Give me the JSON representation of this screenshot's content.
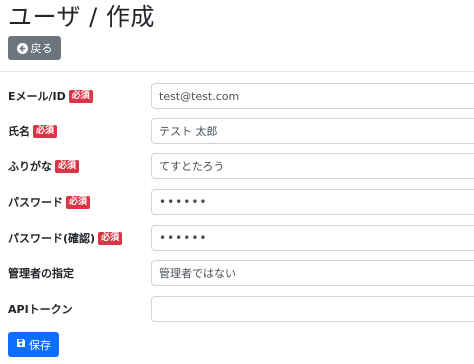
{
  "page": {
    "title": "ユーザ / 作成"
  },
  "toolbar": {
    "back_label": "戻る",
    "back_icon": "arrow-left-circle-icon"
  },
  "badges": {
    "required": "必須"
  },
  "form": {
    "email": {
      "label": "Eメール/ID",
      "required": true,
      "value": "test@test.com"
    },
    "name": {
      "label": "氏名",
      "required": true,
      "value": "テスト 太郎"
    },
    "furigana": {
      "label": "ふりがな",
      "required": true,
      "value": "てすとたろう"
    },
    "password": {
      "label": "パスワード",
      "required": true,
      "value": "••••••"
    },
    "password_confirm": {
      "label": "パスワード(確認)",
      "required": true,
      "value": "••••••"
    },
    "admin": {
      "label": "管理者の指定",
      "required": false,
      "value": "管理者ではない"
    },
    "api_token": {
      "label": "APIトークン",
      "required": false,
      "value": ""
    }
  },
  "footer": {
    "save_label": "保存",
    "save_icon": "save-icon"
  },
  "colors": {
    "back": "#6c757d",
    "save": "#0d6efd",
    "required": "#dc3545"
  }
}
